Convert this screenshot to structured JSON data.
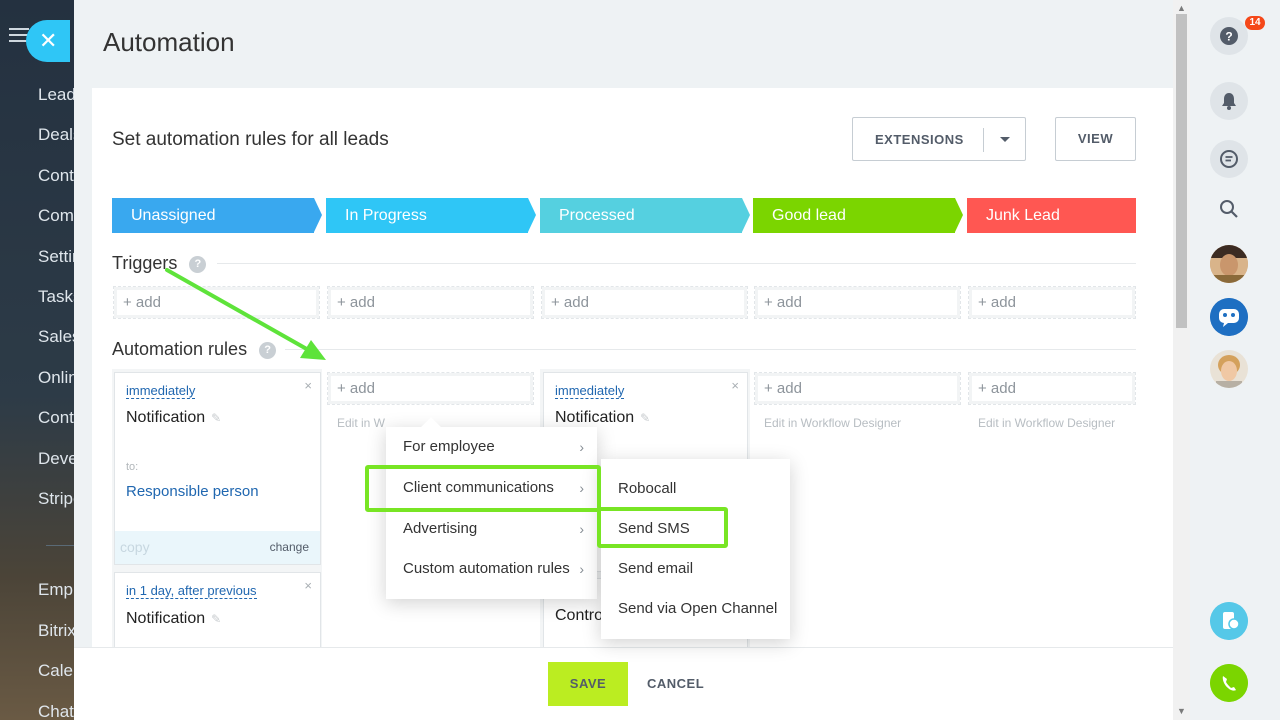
{
  "left_nav": {
    "items": [
      "Leads",
      "Deals",
      "Contacts",
      "Companies",
      "Settings",
      "Tasks",
      "Sales",
      "Online",
      "Contact",
      "Developer",
      "Stripe",
      "Employees",
      "Bitrix",
      "Calendar",
      "Chat"
    ]
  },
  "header": {
    "title": "Automation"
  },
  "toolbar": {
    "subtitle": "Set automation rules for all leads",
    "extensions_label": "EXTENSIONS",
    "view_label": "VIEW"
  },
  "stages": [
    {
      "label": "Unassigned",
      "color": "#39a8ef"
    },
    {
      "label": "In Progress",
      "color": "#2fc6f6"
    },
    {
      "label": "Processed",
      "color": "#55d0e0"
    },
    {
      "label": "Good lead",
      "color": "#7bd500"
    },
    {
      "label": "Junk Lead",
      "color": "#ff5752"
    }
  ],
  "triggers": {
    "title": "Triggers",
    "help": "?",
    "add_label": "+ add"
  },
  "automation": {
    "title": "Automation rules",
    "help": "?",
    "add_label": "+ add",
    "edit_designer": "Edit in Workflow Designer",
    "edit_designer_partial": "Edit in W"
  },
  "rules": {
    "r1": {
      "timing": "immediately",
      "title": "Notification",
      "to_label": "to:",
      "recipient": "Responsible person",
      "copy": "copy",
      "change": "change",
      "close": "×"
    },
    "r2": {
      "timing": "in 1 day, after previous",
      "title": "Notification",
      "close": "×"
    },
    "r3": {
      "timing": "immediately",
      "title": "Notification",
      "close": "×"
    },
    "r4": {
      "title": "Contro"
    }
  },
  "menu": {
    "items": [
      {
        "label": "For employee"
      },
      {
        "label": "Client communications"
      },
      {
        "label": "Advertising"
      },
      {
        "label": "Custom automation rules"
      }
    ],
    "submenu": [
      {
        "label": "Robocall"
      },
      {
        "label": "Send SMS"
      },
      {
        "label": "Send email"
      },
      {
        "label": "Send via Open Channel"
      }
    ],
    "chevron": "›"
  },
  "footer": {
    "save_label": "SAVE",
    "cancel_label": "CANCEL"
  },
  "right_rail": {
    "help_badge": "14"
  },
  "colors": {
    "highlight": "#78e524",
    "save": "#bbed21",
    "link": "#2067b0"
  }
}
